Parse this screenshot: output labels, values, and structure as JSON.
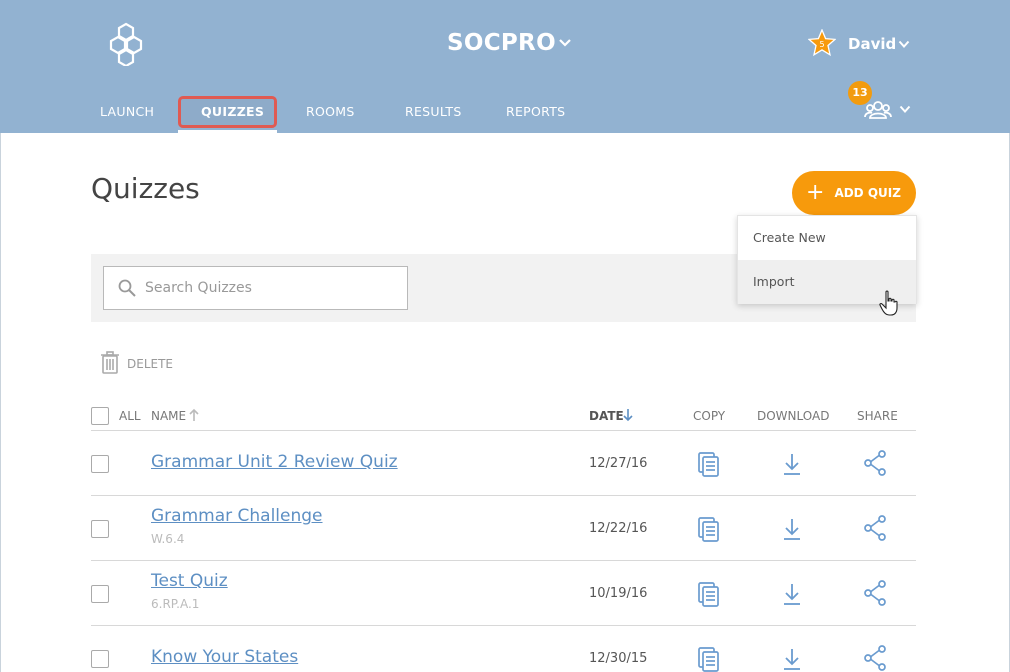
{
  "header": {
    "brand": "SOCPRO",
    "user_name": "David",
    "notification_count": "13",
    "nav": [
      "LAUNCH",
      "QUIZZES",
      "ROOMS",
      "RESULTS",
      "REPORTS"
    ],
    "active_tab": "QUIZZES"
  },
  "page": {
    "title": "Quizzes",
    "add_quiz_label": "ADD QUIZ",
    "dropdown": [
      "Create New",
      "Import"
    ],
    "search_placeholder": "Search Quizzes",
    "delete_label": "DELETE"
  },
  "table": {
    "columns": {
      "all": "ALL",
      "name": "NAME",
      "date": "DATE",
      "copy": "COPY",
      "download": "DOWNLOAD",
      "share": "SHARE"
    },
    "rows": [
      {
        "name": "Grammar Unit 2 Review Quiz",
        "code": "",
        "date": "12/27/16"
      },
      {
        "name": "Grammar Challenge",
        "code": "W.6.4",
        "date": "12/22/16"
      },
      {
        "name": "Test Quiz",
        "code": "6.RP.A.1",
        "date": "10/19/16"
      },
      {
        "name": "Know Your States",
        "code": "",
        "date": "12/30/15"
      }
    ]
  },
  "colors": {
    "header_bg": "#92b2d1",
    "accent_orange": "#f79a0c",
    "link_blue": "#5d8fc3",
    "highlight_red": "#e05a52"
  },
  "icons": [
    "hexagon-logo-icon",
    "chevron-down-icon",
    "star-icon",
    "people-icon",
    "plus-icon",
    "search-icon",
    "trash-icon",
    "sort-arrow-icon",
    "copy-icon",
    "download-icon",
    "share-icon",
    "hand-cursor-icon"
  ]
}
